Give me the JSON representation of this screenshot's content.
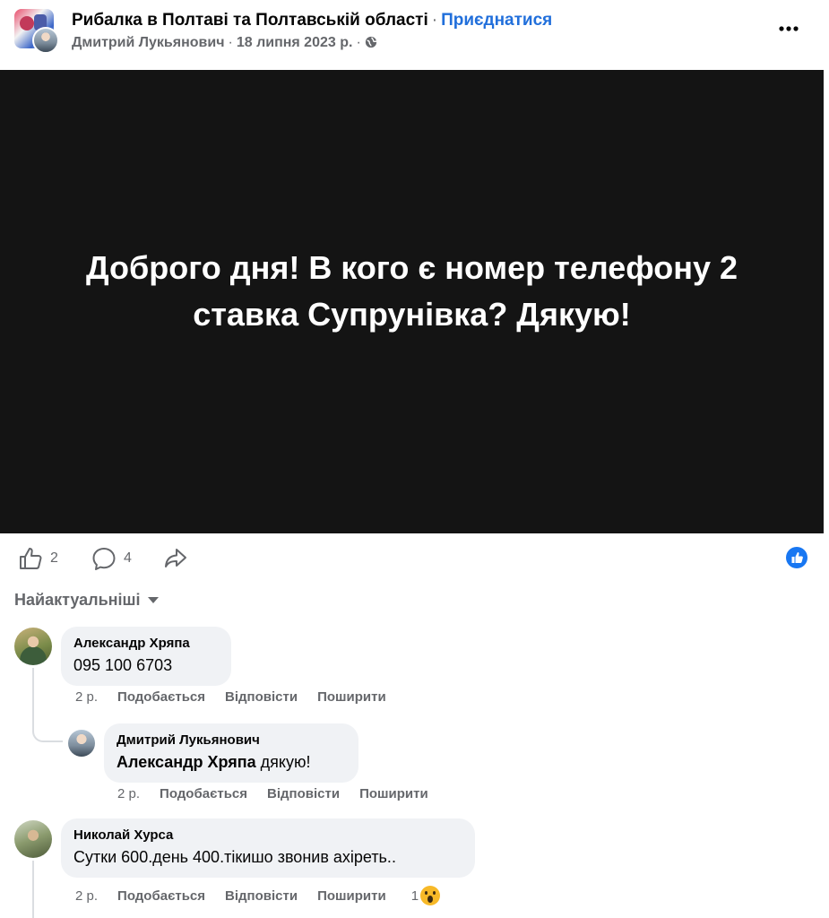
{
  "header": {
    "group_name": "Рибалка в Полтаві та Полтавській області",
    "separator": "·",
    "join_label": "Приєднатися",
    "author": "Дмитрий Лукьянович",
    "date": "18 липня 2023 р.",
    "privacy_icon": "globe-icon",
    "more_icon": "more-options-icon"
  },
  "post": {
    "text": "Доброго дня! В кого є номер телефону 2 ставка Супрунівка? Дякую!",
    "background_color": "#141414"
  },
  "actions": {
    "like_count": "2",
    "comment_count": "4",
    "like_icon": "thumbs-up-icon",
    "comment_icon": "comment-icon",
    "share_icon": "share-icon",
    "reaction_badge_icon": "like-reaction-icon"
  },
  "sort": {
    "label": "Найактуальніші"
  },
  "comments": [
    {
      "author": "Александр Хряпа",
      "text": "095 100 6703",
      "time": "2 р.",
      "like_label": "Подобається",
      "reply_label": "Відповісти",
      "share_label": "Поширити"
    },
    {
      "author": "Дмитрий Лукьянович",
      "mention": "Александр Хряпа",
      "text": " дякую!",
      "time": "2 р.",
      "like_label": "Подобається",
      "reply_label": "Відповісти",
      "share_label": "Поширити"
    },
    {
      "author": "Николай Хурса",
      "text": "Сутки 600.день 400.тікишо звонив ахіреть..",
      "time": "2 р.",
      "like_label": "Подобається",
      "reply_label": "Відповісти",
      "share_label": "Поширити",
      "reaction_count": "1",
      "reaction_icon": "wow-emoji-icon"
    }
  ],
  "colors": {
    "link_blue": "#216fdb",
    "secondary_text": "#65676b",
    "bubble": "#f0f2f5",
    "like_blue": "#1877f2"
  }
}
